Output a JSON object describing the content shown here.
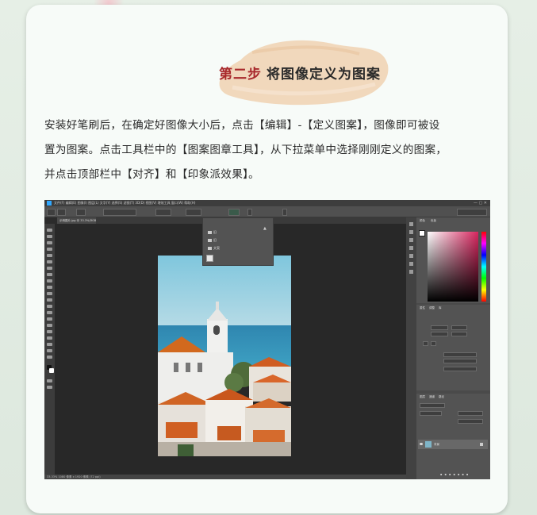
{
  "heading": {
    "step": "第二步",
    "title": "将图像定义为图案"
  },
  "paragraph": {
    "lines": [
      "安装好笔刷后，在确定好图像大小后，点击【编辑】-【定义图案】，图像即可被设",
      "置为图案。点击工具栏中的【图案图章工具】，从下拉菜单中选择刚刚定义的图案，",
      "并点击顶部栏中【对齐】和【印象派效果】。"
    ]
  },
  "colors": {
    "step_red": "#a8292c",
    "brush_beige": "#f0d6b8",
    "card_bg": "#f7fbf8",
    "ps_accent": "#31a8ff"
  },
  "photoshop": {
    "menu": "文件(F)  编辑(E)  图像(I)  图层(L)  文字(Y)  选择(S)  滤镜(T)  3D(D)  视图(V)  增效工具  窗口(W)  帮助(H)",
    "tab": "示例图片.jpg @ 33.3%(RGB/8)",
    "dropdown_items": [
      "旧",
      "旧",
      "文案"
    ],
    "status": "33.33%  1080 像素 x 1920 像素 (72 ppi)",
    "layer_name": "背景",
    "panel_tabs": [
      "颜色",
      "色板"
    ],
    "props_tabs": [
      "属性",
      "调整",
      "库"
    ],
    "layers_tabs": [
      "图层",
      "通道",
      "路径"
    ]
  },
  "icons": [
    "ps-logo-icon",
    "folder-icon",
    "pattern-icon",
    "move-tool-icon",
    "brush-tool-icon",
    "eye-icon",
    "lock-icon"
  ]
}
